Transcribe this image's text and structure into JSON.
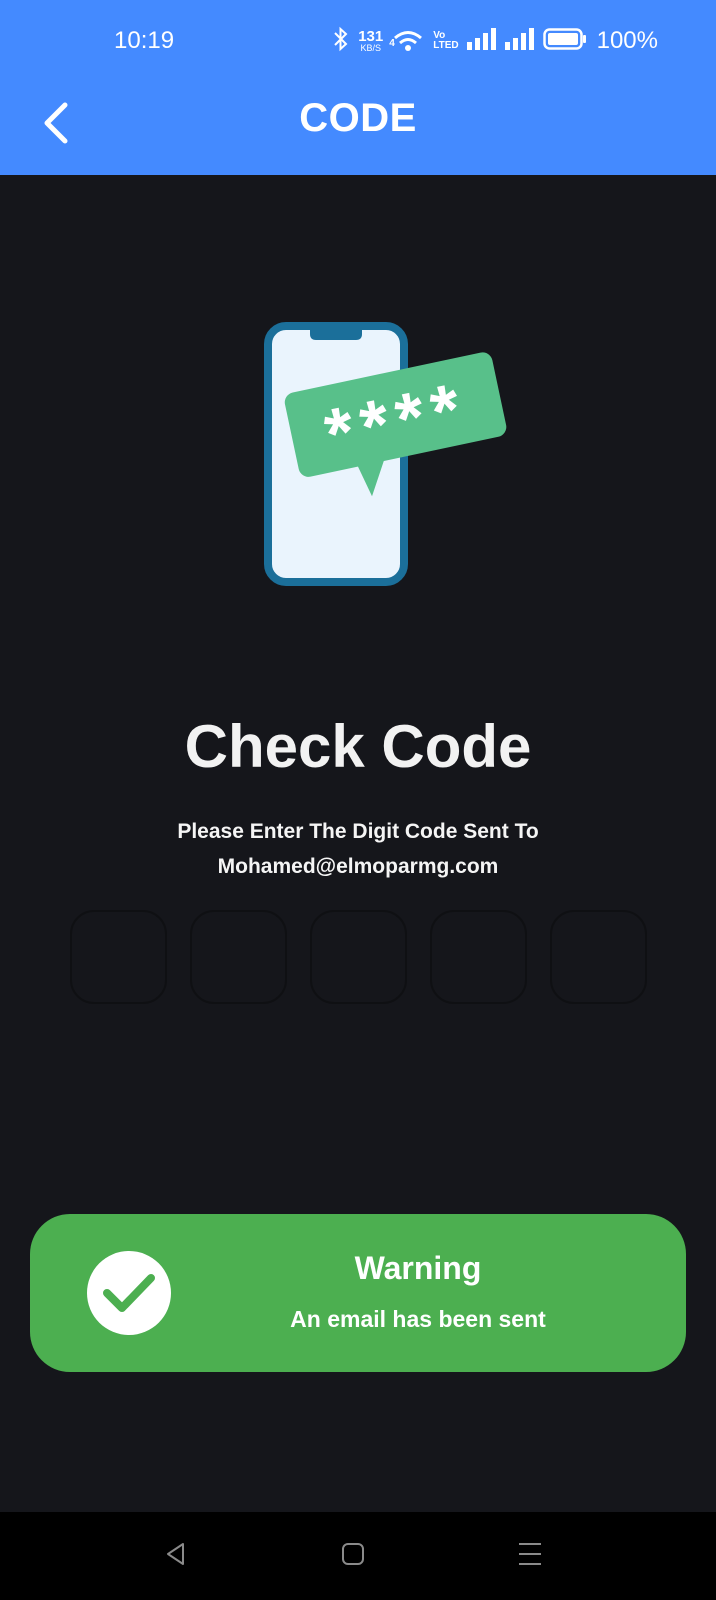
{
  "status_bar": {
    "time": "10:19",
    "net_speed_value": "131",
    "net_speed_unit": "KB/S",
    "wifi_gen": "4",
    "volte_top": "Vo",
    "volte_bottom": "LTED",
    "battery": "100%",
    "icons": [
      "bluetooth-icon",
      "wifi-icon",
      "signal-icon",
      "signal-icon",
      "battery-icon"
    ]
  },
  "app_bar": {
    "title": "CODE",
    "back_icon": "chevron-left-icon"
  },
  "main": {
    "illustration_code": "****",
    "heading": "Check Code",
    "subtitle_line1": "Please Enter The Digit Code Sent To",
    "subtitle_line2": "Mohamed@elmoparmg.com",
    "code_boxes": [
      "",
      "",
      "",
      "",
      ""
    ]
  },
  "toast": {
    "icon": "check-icon",
    "title": "Warning",
    "message": "An email has been sent"
  },
  "nav_bar": {
    "icons": [
      "back-triangle-icon",
      "home-square-icon",
      "menu-lines-icon"
    ]
  },
  "colors": {
    "accent": "#448aff",
    "background": "#15161b",
    "toast": "#4caf50",
    "phone_frame": "#1b6f9a",
    "bubble": "#58c08a"
  }
}
